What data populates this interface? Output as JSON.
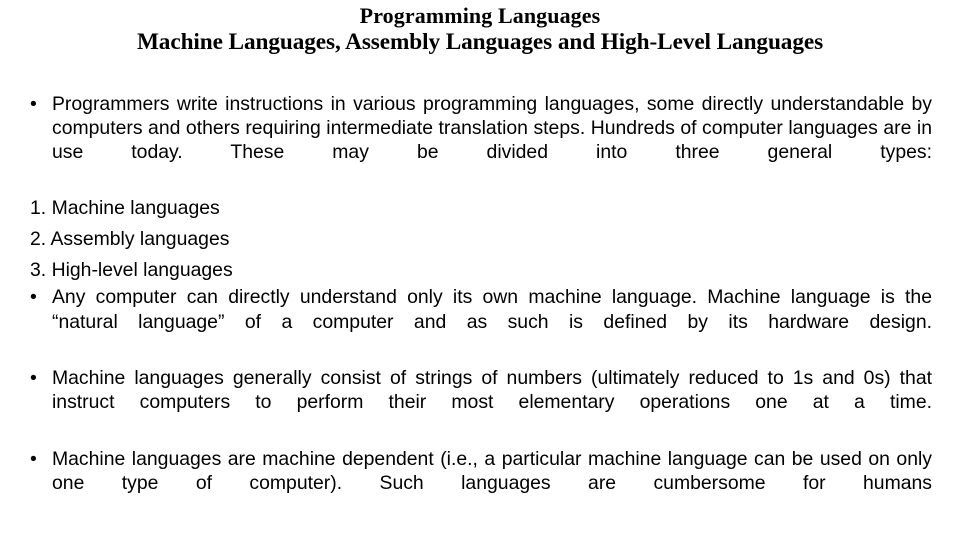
{
  "slide": {
    "background_color": "#ffffff",
    "text_color": "#000000",
    "title": {
      "line1": "Programming Languages",
      "line2": "Machine Languages, Assembly Languages and High-Level Languages"
    },
    "bullet_glyph": "•",
    "paragraphs": [
      {
        "id": "intro",
        "marker": "•",
        "text": "Programmers write instructions in various programming languages, some directly understandable by computers and others requiring intermediate translation steps. Hundreds of computer languages are in use today. These may be divided into three general types:"
      }
    ],
    "numbered_items": [
      {
        "number": "1.",
        "text": "Machine languages"
      },
      {
        "number": "2.",
        "text": "Assembly languages"
      },
      {
        "number": "3.",
        "text": "High-level languages"
      }
    ],
    "bullets_after": [
      {
        "id": "machine-language-def",
        "marker": "•",
        "text": "Any computer can directly understand only its own machine language. Machine language is the “natural language” of a computer and as such is defined by its hardware design."
      },
      {
        "id": "strings-of-numbers",
        "marker": "•",
        "text": "Machine languages generally consist of strings of numbers (ultimately reduced to 1s and 0s) that instruct computers to perform their most elementary operations one at a time."
      },
      {
        "id": "machine-dependent",
        "marker": "•",
        "text": "Machine languages are machine dependent (i.e., a particular machine language can be used on only one type of computer). Such languages are cumbersome for humans"
      }
    ]
  }
}
